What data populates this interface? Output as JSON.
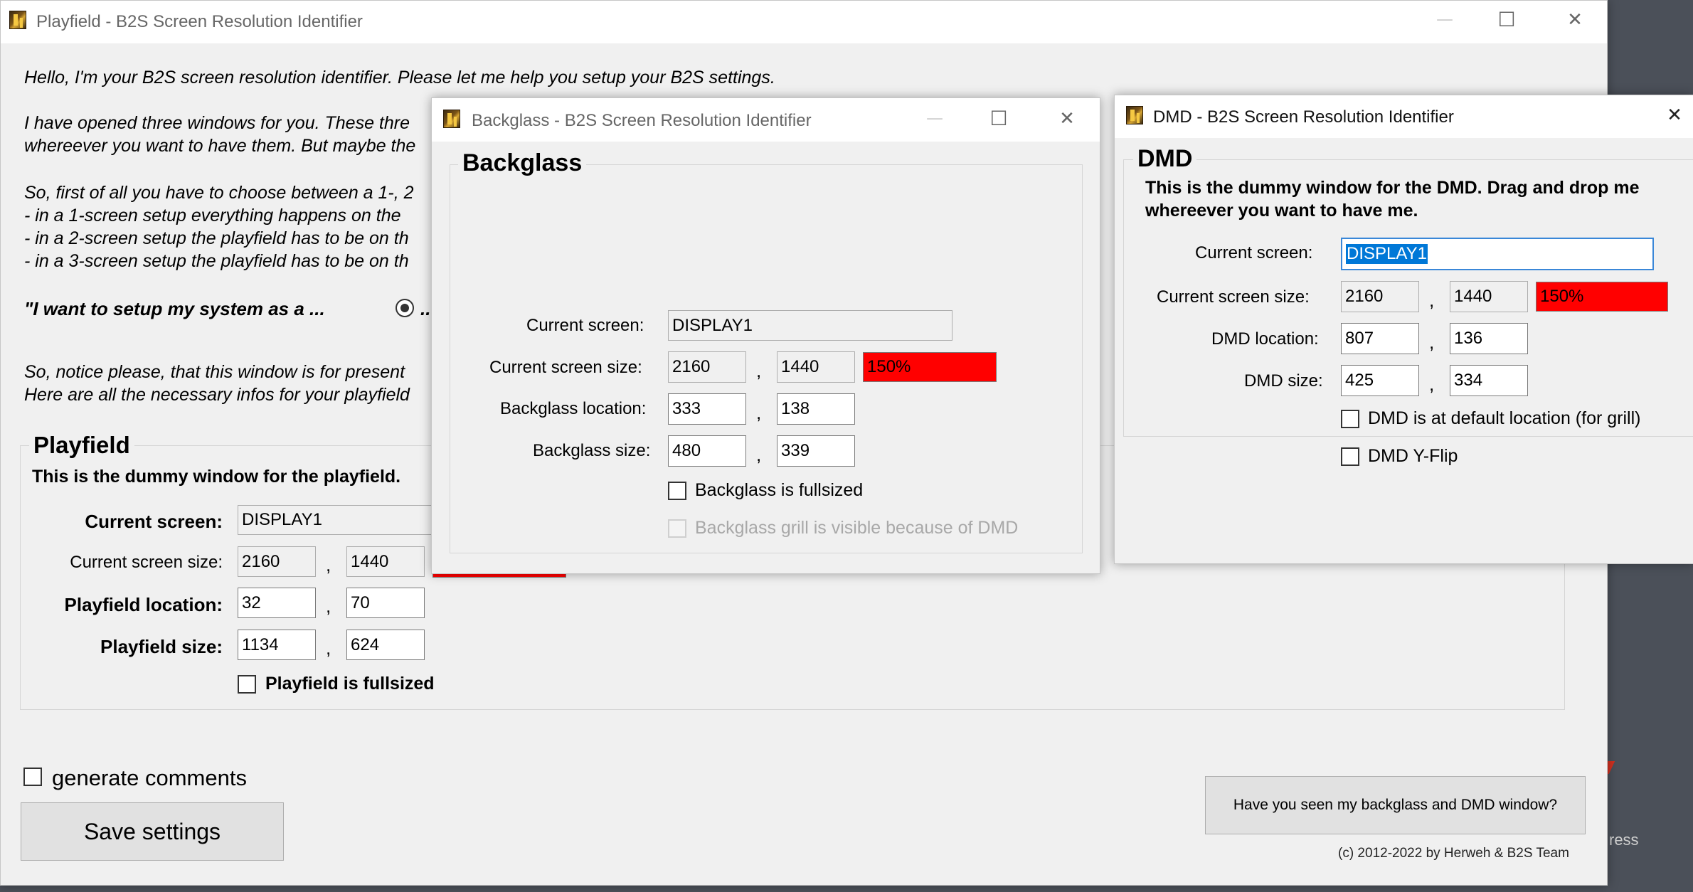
{
  "playfield_window": {
    "title": "Playfield - B2S Screen Resolution Identifier",
    "intro": "Hello, I'm your B2S screen resolution identifier. Please let me help you setup your B2S settings.",
    "para1_line1": "I have opened three windows for you. These thre",
    "para1_line2": "whereever you want to have them. But maybe the",
    "para2_line1": "So, first of all you have to choose between a 1-, 2",
    "para2_line2": " - in a 1-screen setup everything happens on the",
    "para2_line3": " - in a 2-screen setup the playfield has to be on th",
    "para2_line4": " - in a 3-screen setup the playfield has to be on th",
    "setup_question": "\"I want to setup my system as a ...",
    "radio_partial": "...",
    "notice_line1": "So, notice please, that this window is for present",
    "notice_line2": "Here are all the necessary infos for your playfield",
    "group_title": "Playfield",
    "group_desc": "This is the dummy window for the playfield.",
    "current_screen_label": "Current screen:",
    "current_screen_value": "DISPLAY1",
    "screen_size_label": "Current screen size:",
    "screen_width": "2160",
    "screen_height": "1440",
    "location_label": "Playfield location:",
    "location_x": "32",
    "location_y": "70",
    "size_label": "Playfield size:",
    "size_w": "1134",
    "size_h": "624",
    "fullsized_label": "Playfield is fullsized",
    "generate_comments_label": "generate comments",
    "save_button": "Save settings",
    "seen_button": "Have you seen my backglass and DMD window?",
    "copyright": "(c) 2012-2022 by Herweh & B2S Team",
    "comma": ","
  },
  "backglass_window": {
    "title": "Backglass - B2S Screen Resolution Identifier",
    "group_title": "Backglass",
    "current_screen_label": "Current screen:",
    "current_screen_value": "DISPLAY1",
    "screen_size_label": "Current screen size:",
    "screen_width": "2160",
    "screen_height": "1440",
    "scale": "150%",
    "location_label": "Backglass location:",
    "location_x": "333",
    "location_y": "138",
    "size_label": "Backglass size:",
    "size_w": "480",
    "size_h": "339",
    "fullsized_label": "Backglass is fullsized",
    "grill_label": "Backglass grill is visible because of DMD",
    "comma": ","
  },
  "dmd_window": {
    "title": "DMD - B2S Screen Resolution Identifier",
    "group_title": "DMD",
    "desc_line1": "This is the dummy window for the DMD. Drag and drop me",
    "desc_line2": "whereever you want to have me.",
    "current_screen_label": "Current screen:",
    "current_screen_value": "DISPLAY1",
    "screen_size_label": "Current screen size:",
    "screen_width": "2160",
    "screen_height": "1440",
    "scale": "150%",
    "location_label": "DMD location:",
    "location_x": "807",
    "location_y": "136",
    "size_label": "DMD size:",
    "size_w": "425",
    "size_h": "334",
    "default_location_label": "DMD is at default location (for grill)",
    "yflip_label": "DMD Y-Flip",
    "comma": ","
  },
  "desktop": {
    "partial_text": "ress"
  },
  "controls": {
    "minimize": "—",
    "maximize": "☐",
    "close": "✕"
  }
}
